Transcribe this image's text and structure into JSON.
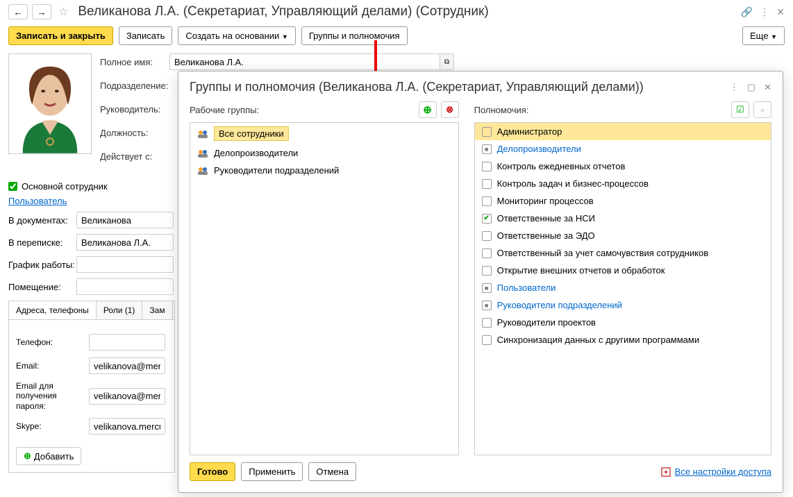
{
  "header": {
    "title": "Великанова Л.А. (Секретариат, Управляющий делами) (Сотрудник)"
  },
  "toolbar": {
    "save_close": "Записать и закрыть",
    "save": "Записать",
    "create_based": "Создать на основании",
    "groups_perms": "Группы и полномочия",
    "more": "Еще"
  },
  "form": {
    "full_name_label": "Полное имя:",
    "full_name_value": "Великанова Л.А.",
    "department_label": "Подразделение:",
    "manager_label": "Руководитель:",
    "position_label": "Должность:",
    "active_from_label": "Действует с:",
    "main_employee": "Основной сотрудник",
    "user_link": "Пользователь",
    "in_documents_label": "В документах:",
    "in_documents_value": "Великанова",
    "in_correspondence_label": "В переписке:",
    "in_correspondence_value": "Великанова Л.А.",
    "schedule_label": "График работы:",
    "room_label": "Помещение:"
  },
  "tabs": {
    "items": [
      "Адреса, телефоны",
      "Роли (1)",
      "Зам"
    ],
    "phone_label": "Телефон:",
    "email_label": "Email:",
    "email_value": "velikanova@mercury",
    "email_password_label": "Email для получения пароля:",
    "email_password_value": "velikanova@mercury",
    "skype_label": "Skype:",
    "skype_value": "velikanova.mercury",
    "add_button": "Добавить"
  },
  "modal": {
    "title": "Группы и полномочия (Великанова Л.А. (Секретариат, Управляющий делами))",
    "workgroups_label": "Рабочие группы:",
    "permissions_label": "Полномочия:",
    "workgroups": [
      {
        "label": "Все сотрудники",
        "selected": true
      },
      {
        "label": "Делопроизводители",
        "selected": false
      },
      {
        "label": "Руководители подразделений",
        "selected": false
      }
    ],
    "permissions": [
      {
        "label": "Администратор",
        "state": "unchecked",
        "link": false,
        "selected": true
      },
      {
        "label": "Делопроизводители",
        "state": "mixed",
        "link": true
      },
      {
        "label": "Контроль ежедневных отчетов",
        "state": "unchecked",
        "link": false
      },
      {
        "label": "Контроль задач и бизнес-процессов",
        "state": "unchecked",
        "link": false
      },
      {
        "label": "Мониторинг процессов",
        "state": "unchecked",
        "link": false
      },
      {
        "label": "Ответственные за НСИ",
        "state": "checked",
        "link": false
      },
      {
        "label": "Ответственные за ЭДО",
        "state": "unchecked",
        "link": false
      },
      {
        "label": "Ответственный за учет самочувствия сотрудников",
        "state": "unchecked",
        "link": false
      },
      {
        "label": "Открытие внешних отчетов и обработок",
        "state": "unchecked",
        "link": false
      },
      {
        "label": "Пользователи",
        "state": "mixed",
        "link": true
      },
      {
        "label": "Руководители подразделений",
        "state": "mixed",
        "link": true
      },
      {
        "label": "Руководители проектов",
        "state": "unchecked",
        "link": false
      },
      {
        "label": "Синхронизация данных с другими программами",
        "state": "unchecked",
        "link": false
      }
    ],
    "done": "Готово",
    "apply": "Применить",
    "cancel": "Отмена",
    "all_settings": "Все настройки доступа"
  }
}
